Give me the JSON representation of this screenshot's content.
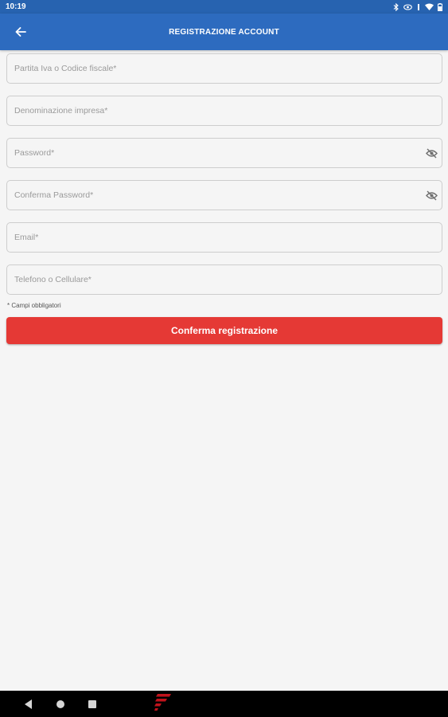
{
  "status_bar": {
    "time": "10:19",
    "icons": [
      "bluetooth-icon",
      "eye-icon",
      "vibrate-icon",
      "wifi-icon",
      "battery-icon"
    ]
  },
  "app_bar": {
    "back_icon": "arrow-left-icon",
    "title": "REGISTRAZIONE ACCOUNT"
  },
  "form": {
    "fields": [
      {
        "name": "vat-or-tax-code",
        "placeholder": "Partita Iva o Codice fiscale*",
        "value": "",
        "type": "text"
      },
      {
        "name": "company-name",
        "placeholder": "Denominazione impresa*",
        "value": "",
        "type": "text"
      },
      {
        "name": "password",
        "placeholder": "Password*",
        "value": "",
        "type": "password",
        "trailing_icon": "eye-off-icon"
      },
      {
        "name": "confirm-password",
        "placeholder": "Conferma Password*",
        "value": "",
        "type": "password",
        "trailing_icon": "eye-off-icon"
      },
      {
        "name": "email",
        "placeholder": "Email*",
        "value": "",
        "type": "email"
      },
      {
        "name": "phone",
        "placeholder": "Telefono o Cellulare*",
        "value": "",
        "type": "tel"
      }
    ],
    "required_note": "* Campi obbligatori",
    "submit_label": "Conferma registrazione"
  },
  "colors": {
    "status_bar": "#2763b0",
    "app_bar": "#2d6bbf",
    "submit_button": "#e53935",
    "background": "#f5f5f5",
    "nav_bar": "#000000"
  },
  "nav_bar": {
    "buttons": [
      "back-triangle-icon",
      "home-circle-icon",
      "recents-square-icon"
    ],
    "logo": "app-logo-icon"
  }
}
